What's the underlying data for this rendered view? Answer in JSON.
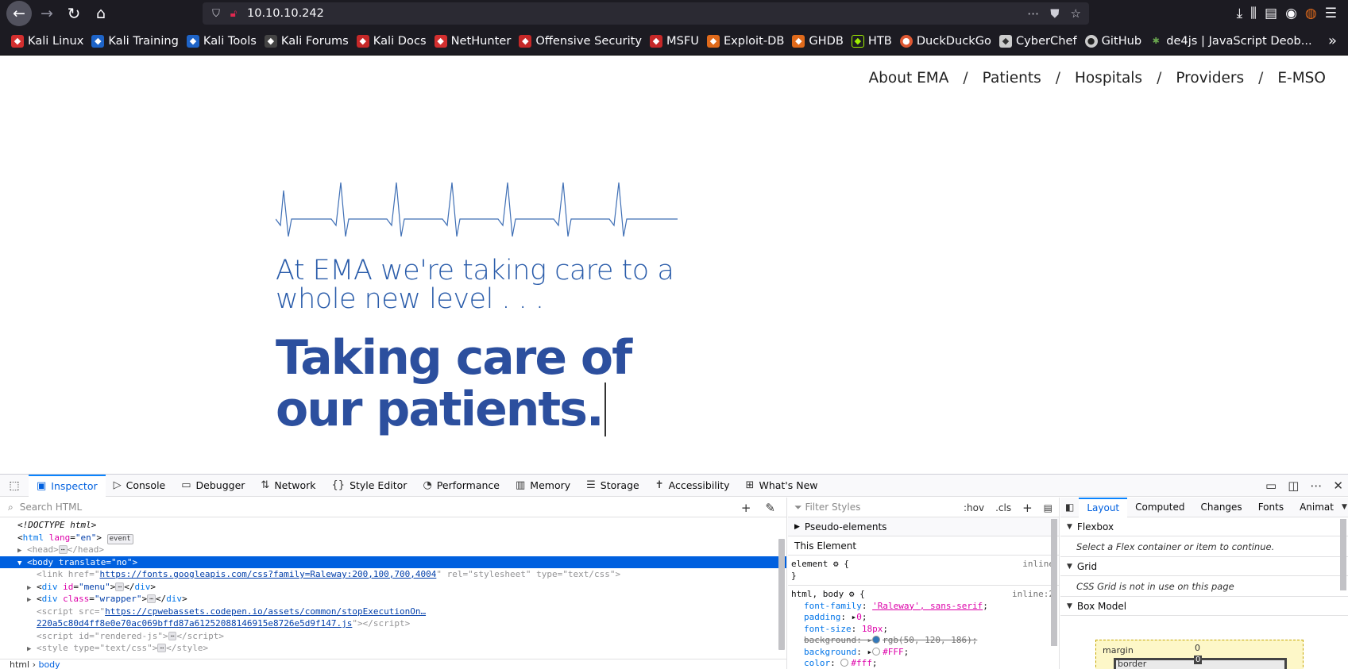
{
  "browser": {
    "url": "10.10.10.242",
    "bookmarks": [
      {
        "label": "Kali Linux",
        "color": "#d32f2f"
      },
      {
        "label": "Kali Training",
        "color": "#1e64c8"
      },
      {
        "label": "Kali Tools",
        "color": "#1e64c8"
      },
      {
        "label": "Kali Forums",
        "color": "#444444"
      },
      {
        "label": "Kali Docs",
        "color": "#c62828"
      },
      {
        "label": "NetHunter",
        "color": "#d32f2f"
      },
      {
        "label": "Offensive Security",
        "color": "#c62828"
      },
      {
        "label": "MSFU",
        "color": "#c62828"
      },
      {
        "label": "Exploit-DB",
        "color": "#e06a1b"
      },
      {
        "label": "GHDB",
        "color": "#e06a1b"
      },
      {
        "label": "HTB",
        "color": "#9fef00"
      },
      {
        "label": "DuckDuckGo",
        "color": "#de5833"
      },
      {
        "label": "CyberChef",
        "color": "#cccccc"
      },
      {
        "label": "GitHub",
        "color": "#cccccc"
      },
      {
        "label": "de4js | JavaScript Deob...",
        "color": "#6aa84f"
      }
    ]
  },
  "page": {
    "menu": [
      "About EMA",
      "Patients",
      "Hospitals",
      "Providers",
      "E-MSO"
    ],
    "menu_separator": "/",
    "tagline": "At EMA we're taking care to a whole new level . . .",
    "headline_line1": "Taking care of",
    "headline_line2": "our patients."
  },
  "devtools": {
    "tabs": [
      "Inspector",
      "Console",
      "Debugger",
      "Network",
      "Style Editor",
      "Performance",
      "Memory",
      "Storage",
      "Accessibility",
      "What's New"
    ],
    "active_tab": "Inspector",
    "search_placeholder": "Search HTML",
    "tree": {
      "doctype": "<!DOCTYPE html>",
      "html_open": "html",
      "html_lang_attr": "lang",
      "html_lang_val": "\"en\"",
      "html_badge": "event",
      "head": "head",
      "body_tag": "body",
      "body_attr": "translate",
      "body_val": "\"no\"",
      "link_tag": "link",
      "link_href": "https://fonts.googleapis.com/css?family=Raleway:200,100,700,4004",
      "link_rel": "\"stylesheet\"",
      "link_type": "\"text/css\"",
      "div_menu_id": "\"menu\"",
      "div_wrapper_class": "\"wrapper\"",
      "script_src_1": "https://cpwebassets.codepen.io/assets/common/stopExecutionOn…",
      "script_src_2": "220a5c80d4ff8e0e70ac069bffd87a61252088146915e8726e5d9f147.js",
      "script_rendered_id": "\"rendered-js\"",
      "style_type": "\"text/css\""
    },
    "breadcrumbs": [
      "html",
      "body"
    ],
    "rules": {
      "filter_placeholder": "Filter Styles",
      "hov": ":hov",
      "cls": ".cls",
      "pseudo": "Pseudo-elements",
      "this_element": "This Element",
      "element_selector": "element",
      "element_src": "inline",
      "rule2_selector": "html, body",
      "rule2_src": "inline:2",
      "props": [
        {
          "name": "font-family",
          "value": "'Raleway', sans-serif"
        },
        {
          "name": "padding",
          "value": "0"
        },
        {
          "name": "font-size",
          "value": "18px"
        },
        {
          "name": "background",
          "value": "rgb(50, 120, 186)",
          "struck": true
        },
        {
          "name": "background",
          "value": "#FFF"
        },
        {
          "name": "color",
          "value": "#fff"
        }
      ]
    },
    "layout": {
      "tabs": [
        "Layout",
        "Computed",
        "Changes",
        "Fonts",
        "Animat"
      ],
      "active_tab": "Layout",
      "flexbox_title": "Flexbox",
      "flexbox_msg": "Select a Flex container or item to continue.",
      "grid_title": "Grid",
      "grid_msg": "CSS Grid is not in use on this page",
      "boxmodel_title": "Box Model",
      "margin_label": "margin",
      "margin_value": "0",
      "border_label": "border",
      "border_value": "0"
    }
  }
}
